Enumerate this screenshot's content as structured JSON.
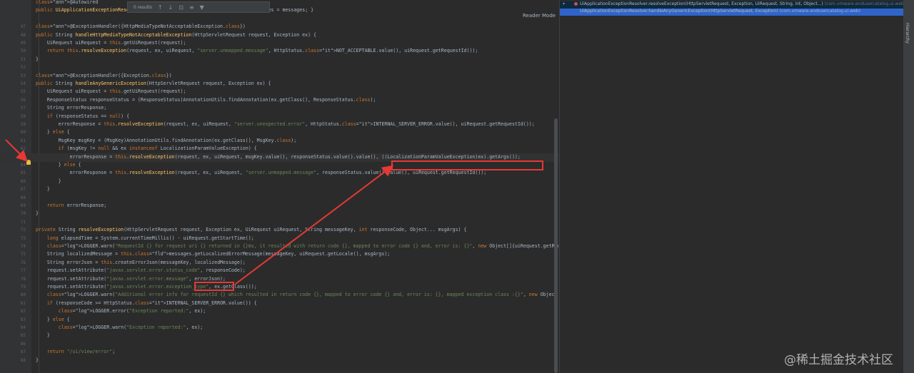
{
  "findbar": {
    "results": "0 results",
    "icons": [
      "up-arrow-icon",
      "down-arrow-icon",
      "find-in-selection-icon",
      "regex-icon",
      "filter-icon"
    ]
  },
  "reader_mode": "Reader Mode",
  "editor": {
    "lines": [
      {
        "n": "",
        "t": "@Autowired",
        "ht": true
      },
      {
        "n": "",
        "t": "public UiApplicationExceptionResolver(Messages messages) { this.messages = messages; }"
      },
      {
        "n": "",
        "t": ""
      },
      {
        "n": "47",
        "t": "@ExceptionHandler({HttpMediaTypeNotAcceptableException.class})"
      },
      {
        "n": "48",
        "t": "public String handleHttpMediaTypeNotAcceptableException(HttpServletRequest request, Exception ex) {"
      },
      {
        "n": "49",
        "t": "    UiRequest uiRequest = this.getUiRequest(request);"
      },
      {
        "n": "50",
        "t": "    return this.resolveException(request, ex, uiRequest, \"server.unmapped.message\", HttpStatus.NOT_ACCEPTABLE.value(), uiRequest.getRequestId());"
      },
      {
        "n": "51",
        "t": "}"
      },
      {
        "n": "52",
        "t": ""
      },
      {
        "n": "53",
        "t": "@ExceptionHandler({Exception.class})"
      },
      {
        "n": "54",
        "t": "public String handleAnyGenericException(HttpServletRequest request, Exception ex) {"
      },
      {
        "n": "55",
        "t": "    UiRequest uiRequest = this.getUiRequest(request);"
      },
      {
        "n": "56",
        "t": "    ResponseStatus responseStatus = (ResponseStatus)AnnotationUtils.findAnnotation(ex.getClass(), ResponseStatus.class);"
      },
      {
        "n": "57",
        "t": "    String errorResponse;"
      },
      {
        "n": "58",
        "t": "    if (responseStatus == null) {"
      },
      {
        "n": "59",
        "t": "        errorResponse = this.resolveException(request, ex, uiRequest, \"server.unexpected.error\", HttpStatus.INTERNAL_SERVER_ERROR.value(), uiRequest.getRequestId());"
      },
      {
        "n": "60",
        "t": "    } else {"
      },
      {
        "n": "61",
        "t": "        MsgKey msgKey = (MsgKey)AnnotationUtils.findAnnotation(ex.getClass(), MsgKey.class);"
      },
      {
        "n": "62",
        "t": "        if (msgKey != null && ex instanceof LocalizationParamValueException) {"
      },
      {
        "n": "63",
        "t": "            errorResponse = this.resolveException(request, ex, uiRequest, msgKey.value(), responseStatus.value().value(), ((LocalizationParamValueException)ex).getArgs());"
      },
      {
        "n": "64",
        "t": "        } else {"
      },
      {
        "n": "65",
        "t": "            errorResponse = this.resolveException(request, ex, uiRequest, \"server.unmapped.message\", responseStatus.value().value(), uiRequest.getRequestId());"
      },
      {
        "n": "66",
        "t": "        }"
      },
      {
        "n": "67",
        "t": "    }"
      },
      {
        "n": "68",
        "t": ""
      },
      {
        "n": "69",
        "t": "    return errorResponse;"
      },
      {
        "n": "70",
        "t": "}"
      },
      {
        "n": "71",
        "t": ""
      },
      {
        "n": "72",
        "t": "private String resolveException(HttpServletRequest request, Exception ex, UiRequest uiRequest, String messageKey, int responseCode, Object... msgArgs) {"
      },
      {
        "n": "73",
        "t": "    long elapsedTime = System.currentTimeMillis() - uiRequest.getStartTime();"
      },
      {
        "n": "74",
        "t": "    LOGGER.warn(\"RequestId {} for request uri {} returned in {}ms, it resulted with return code {}, mapped to error code {} and, error is: {}\", new Object[]{uiRequest.getRequestId("
      },
      {
        "n": "75",
        "t": "    String localizedMessage = this.messages.getLocalizedErrorMessage(messageKey, uiRequest.getLocale(), msgArgs);"
      },
      {
        "n": "76",
        "t": "    String errorJson = this.createErrorJson(messageKey, localizedMessage);"
      },
      {
        "n": "77",
        "t": "    request.setAttribute(\"javax.servlet.error.status_code\", responseCode);"
      },
      {
        "n": "78",
        "t": "    request.setAttribute(\"javax.servlet.error.message\", errorJson);"
      },
      {
        "n": "79",
        "t": "    request.setAttribute(\"javax.servlet.error.exception_type\", ex.getClass());"
      },
      {
        "n": "80",
        "t": "    LOGGER.warn(\"Additional error info for requestId {} which resulted in return code {}, mapped to error code {} and, error is: {}, mapped exception class :{}\", new Object[]{uiRe"
      },
      {
        "n": "81",
        "t": "    if (responseCode >= HttpStatus.INTERNAL_SERVER_ERROR.value()) {"
      },
      {
        "n": "82",
        "t": "        LOGGER.error(\"Exception reported:\", ex);"
      },
      {
        "n": "83",
        "t": "    } else {"
      },
      {
        "n": "84",
        "t": "        LOGGER.warn(\"Exception reported:\", ex);"
      },
      {
        "n": "85",
        "t": "    }"
      },
      {
        "n": "86",
        "t": ""
      },
      {
        "n": "87",
        "t": "    return \"/ui/view/error\";"
      },
      {
        "n": "88",
        "t": "}"
      }
    ]
  },
  "frames": [
    {
      "method": "UiApplicationExceptionResolver.resolveException(HttpServletRequest, Exception, UiRequest, String, int, Object...)",
      "pkg": "(com.vmware.endusercatalog.ui.web)"
    },
    {
      "method": "UiApplicationExceptionResolver.handleAnyGenericException(HttpServletRequest, Exception)",
      "pkg": "(com.vmware.endusercatalog.ui.web)"
    }
  ],
  "side_tab": "Hierarchy",
  "watermark": "@稀土掘金技术社区",
  "colors": {
    "highlight_box": "#e53935",
    "arrow": "#e53935",
    "editor_bg": "#2b2b2b"
  }
}
